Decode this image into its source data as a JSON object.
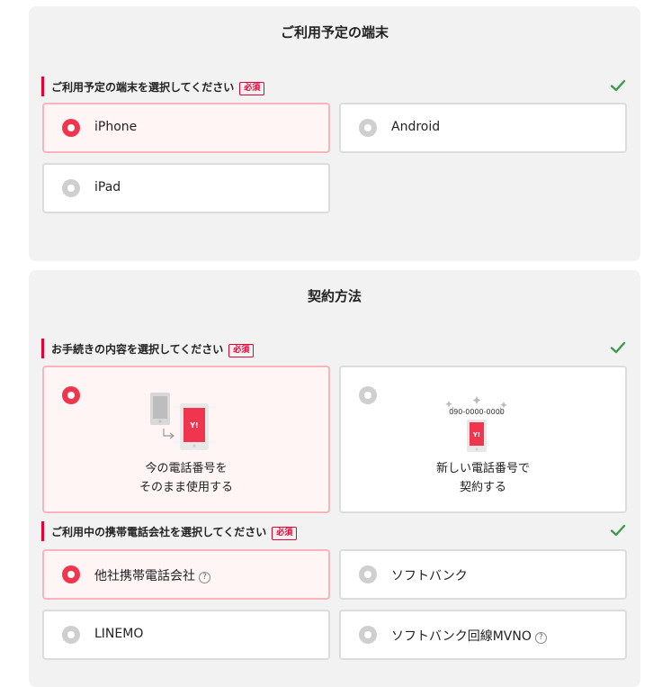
{
  "device_section": {
    "title": "ご利用予定の端末",
    "question": "ご利用予定の端末を選択してください",
    "required": "必須",
    "options": [
      {
        "label": "iPhone",
        "selected": true
      },
      {
        "label": "Android",
        "selected": false
      },
      {
        "label": "iPad",
        "selected": false
      }
    ]
  },
  "contract_section": {
    "title": "契約方法",
    "question": "お手続きの内容を選択してください",
    "required": "必須",
    "options": [
      {
        "line1": "今の電話番号を",
        "line2": "そのまま使用する",
        "selected": true
      },
      {
        "line1": "新しい電話番号で",
        "line2": "契約する",
        "number": "090-0000-0000",
        "selected": false
      }
    ],
    "carrier_question": "ご利用中の携帯電話会社を選択してください",
    "carrier_required": "必須",
    "carriers": [
      {
        "label": "他社携帯電話会社",
        "selected": true,
        "help": "?"
      },
      {
        "label": "ソフトバンク",
        "selected": false
      },
      {
        "label": "LINEMO",
        "selected": false
      },
      {
        "label": "ソフトバンク回線MVNO",
        "selected": false,
        "help": "?"
      }
    ]
  },
  "badge_text": "Y!",
  "colors": {
    "accent": "#e60033",
    "radio_selected": "#f0364f",
    "check": "#3d9a4a",
    "panel": "#f2f2f2"
  }
}
